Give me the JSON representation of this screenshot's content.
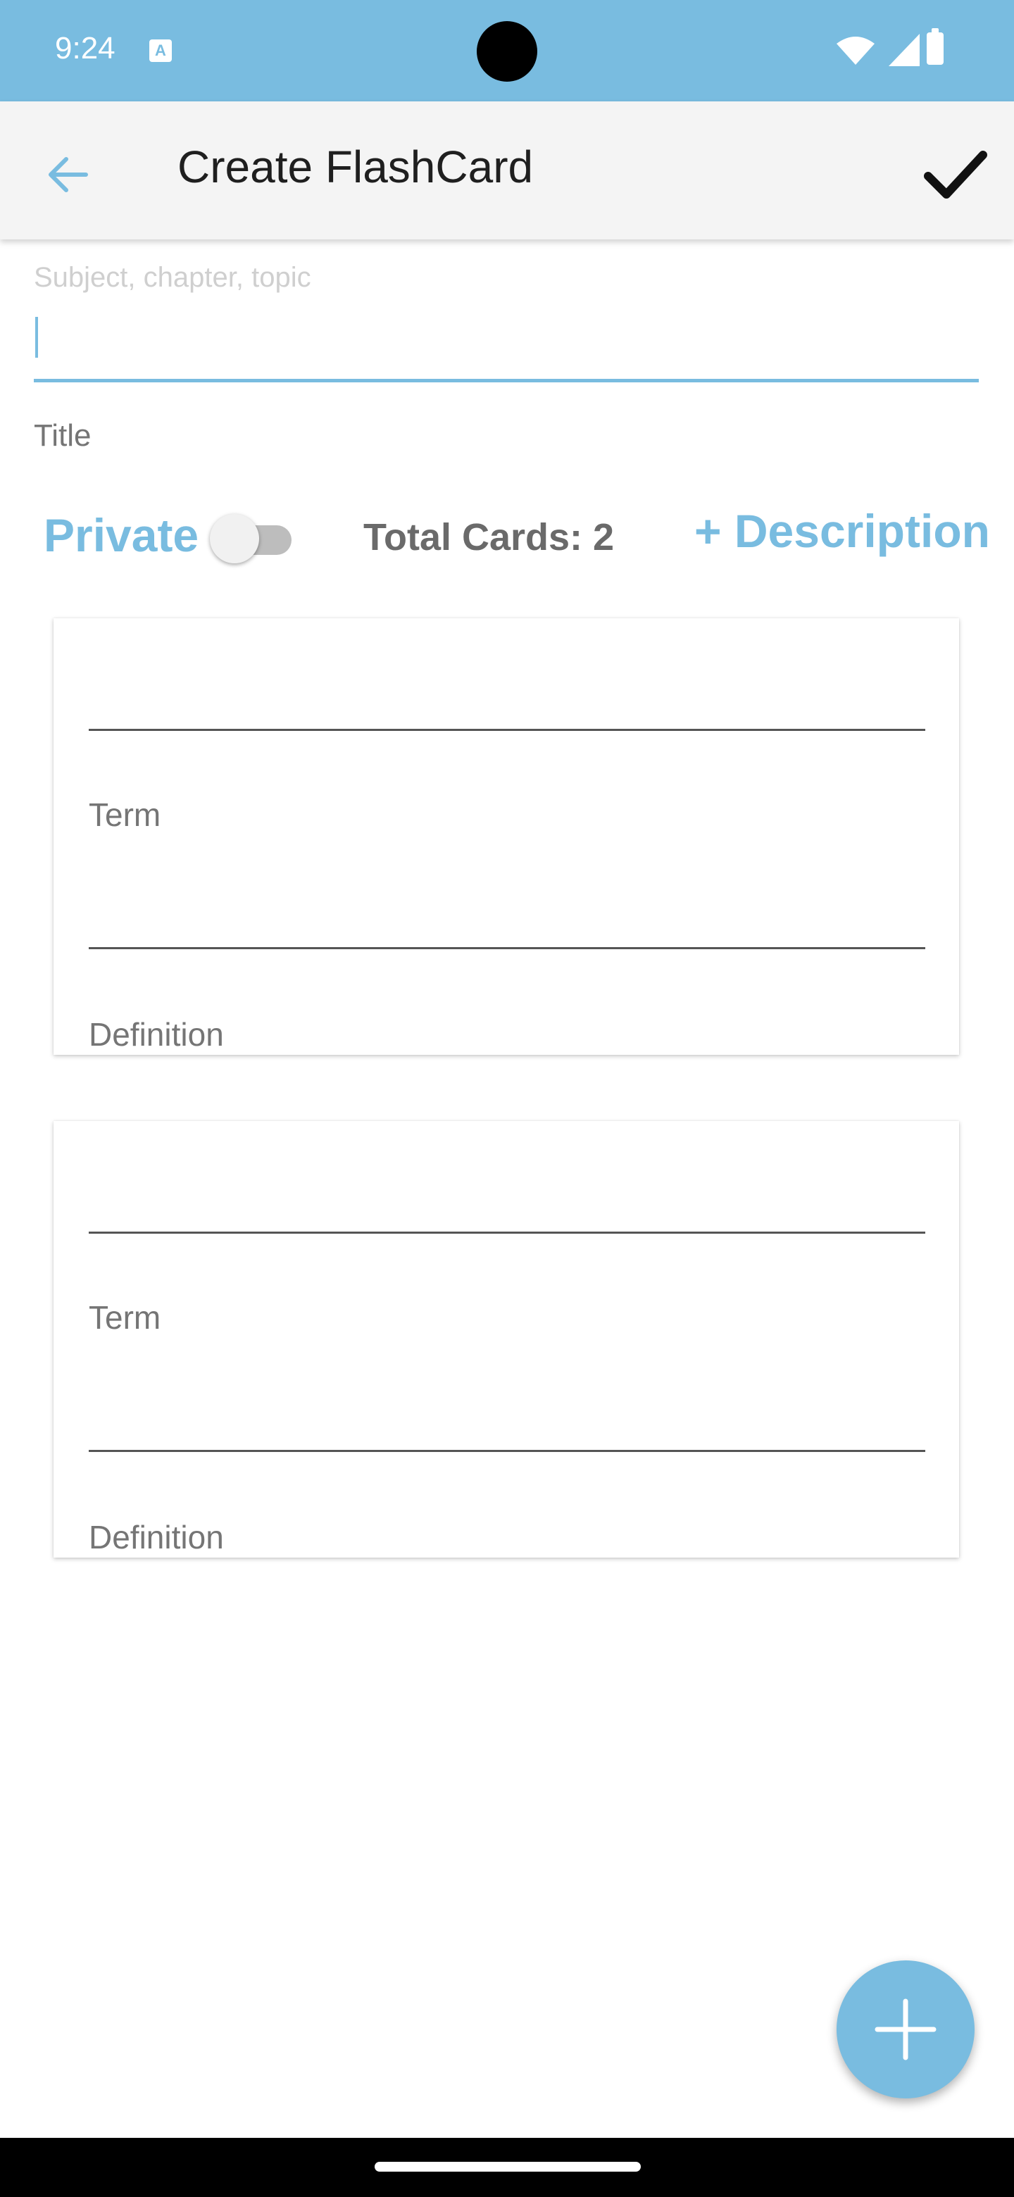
{
  "status_bar": {
    "time": "9:24",
    "icons": [
      "a-keyboard-icon",
      "wifi-icon",
      "signal-icon",
      "battery-icon"
    ]
  },
  "app_bar": {
    "title": "Create FlashCard",
    "back_icon": "arrow-left-icon",
    "confirm_icon": "checkmark-icon"
  },
  "form": {
    "subject_placeholder": "Subject, chapter, topic",
    "subject_value": "",
    "title_label": "Title"
  },
  "controls": {
    "private_label": "Private",
    "private_enabled": false,
    "total_cards_text": "Total Cards: 2",
    "add_description_label": "+ Description"
  },
  "cards": [
    {
      "term_label": "Term",
      "term_value": "",
      "definition_label": "Definition",
      "definition_value": ""
    },
    {
      "term_label": "Term",
      "term_value": "",
      "definition_label": "Definition",
      "definition_value": ""
    }
  ],
  "fab": {
    "icon": "plus-icon"
  },
  "colors": {
    "accent": "#79BCE0",
    "app_bar_bg": "#F4F4F4",
    "muted_text": "#757575"
  }
}
